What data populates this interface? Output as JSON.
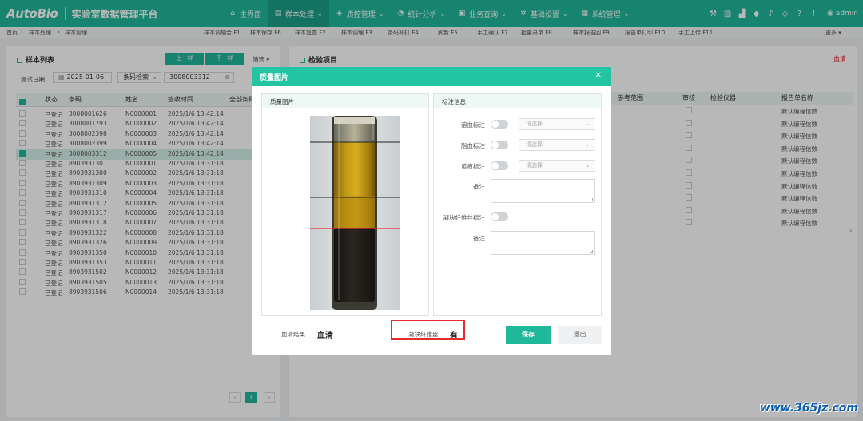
{
  "header": {
    "logo": "AutoBio",
    "app_title": "实验室数据管理平台",
    "nav": [
      {
        "icon": "home-icon",
        "glyph": "⌂",
        "label": "主界面",
        "has_menu": false,
        "active": false
      },
      {
        "icon": "sample-icon",
        "glyph": "▤",
        "label": "样本处理",
        "has_menu": true,
        "active": true
      },
      {
        "icon": "quality-icon",
        "glyph": "◈",
        "label": "质控管理",
        "has_menu": true,
        "active": false
      },
      {
        "icon": "chart-icon",
        "glyph": "◔",
        "label": "统计分析",
        "has_menu": true,
        "active": false
      },
      {
        "icon": "business-icon",
        "glyph": "▣",
        "label": "业务查询",
        "has_menu": true,
        "active": false
      },
      {
        "icon": "gear-icon",
        "glyph": "✲",
        "label": "基础设置",
        "has_menu": true,
        "active": false
      },
      {
        "icon": "grid-icon",
        "glyph": "▦",
        "label": "系统管理",
        "has_menu": true,
        "active": false
      }
    ],
    "tools": [
      {
        "icon": "hammer-icon",
        "glyph": "⚒"
      },
      {
        "icon": "chart-bar-icon",
        "glyph": "▥"
      },
      {
        "icon": "building-icon",
        "glyph": "▟"
      },
      {
        "icon": "shield-icon",
        "glyph": "◆"
      },
      {
        "icon": "bell-icon",
        "glyph": "♪"
      },
      {
        "icon": "cube-icon",
        "glyph": "◇"
      },
      {
        "icon": "help-icon",
        "glyph": "?"
      },
      {
        "icon": "info-icon",
        "glyph": "!"
      }
    ],
    "user": "admin"
  },
  "breadcrumb": {
    "home": "首页",
    "section": "样本处理",
    "page": "样本管理"
  },
  "shortcuts": [
    "样本调轴合 F1",
    "样本保存 F6",
    "样本复查 F2",
    "样本调理 F3",
    "条码补打 F4",
    "刷新 F5",
    "手工确认 F7",
    "批量录单 F8",
    "样本报告回 F9",
    "报告单打印 F10",
    "手工上传 F11",
    "更多 ▾"
  ],
  "left_panel": {
    "title": "样本列表",
    "prev_button": "上一样",
    "next_button": "下一样",
    "filter_button": "筛选 ▾",
    "date_label": "测试日期",
    "date_value": "2025-01-06",
    "search_type": "条码检索",
    "search_value": "3008003312",
    "columns": [
      "状态",
      "条码",
      "姓名",
      "签收时间",
      "全部条码"
    ],
    "rows": [
      {
        "status": "已登记",
        "barcode": "3008001626",
        "name": "N0000001",
        "time": "2025/1/6 13:42:14",
        "selected": false
      },
      {
        "status": "已登记",
        "barcode": "3008001793",
        "name": "N0000002",
        "time": "2025/1/6 13:42:14",
        "selected": false
      },
      {
        "status": "已登记",
        "barcode": "3008002398",
        "name": "N0000003",
        "time": "2025/1/6 13:42:14",
        "selected": false
      },
      {
        "status": "已登记",
        "barcode": "3008002399",
        "name": "N0000004",
        "time": "2025/1/6 13:42:14",
        "selected": false
      },
      {
        "status": "已登记",
        "barcode": "3008003312",
        "name": "N0000005",
        "time": "2025/1/6 13:42:14",
        "selected": true
      },
      {
        "status": "已登记",
        "barcode": "8903931301",
        "name": "N0000001",
        "time": "2025/1/6 13:31:18",
        "selected": false
      },
      {
        "status": "已登记",
        "barcode": "8903931300",
        "name": "N0000002",
        "time": "2025/1/6 13:31:18",
        "selected": false
      },
      {
        "status": "已登记",
        "barcode": "8903931309",
        "name": "N0000003",
        "time": "2025/1/6 13:31:18",
        "selected": false
      },
      {
        "status": "已登记",
        "barcode": "8903931310",
        "name": "N0000004",
        "time": "2025/1/6 13:31:18",
        "selected": false
      },
      {
        "status": "已登记",
        "barcode": "8903931312",
        "name": "N0000005",
        "time": "2025/1/6 13:31:18",
        "selected": false
      },
      {
        "status": "已登记",
        "barcode": "8903931317",
        "name": "N0000006",
        "time": "2025/1/6 13:31:18",
        "selected": false
      },
      {
        "status": "已登记",
        "barcode": "8903931318",
        "name": "N0000007",
        "time": "2025/1/6 13:31:18",
        "selected": false
      },
      {
        "status": "已登记",
        "barcode": "8903931322",
        "name": "N0000008",
        "time": "2025/1/6 13:31:18",
        "selected": false
      },
      {
        "status": "已登记",
        "barcode": "8903931326",
        "name": "N0000009",
        "time": "2025/1/6 13:31:18",
        "selected": false
      },
      {
        "status": "已登记",
        "barcode": "8903931350",
        "name": "N0000010",
        "time": "2025/1/6 13:31:18",
        "selected": false
      },
      {
        "status": "已登记",
        "barcode": "8903931353",
        "name": "N0000011",
        "time": "2025/1/6 13:31:18",
        "selected": false
      },
      {
        "status": "已登记",
        "barcode": "8903931502",
        "name": "N0000012",
        "time": "2025/1/6 13:31:18",
        "selected": false
      },
      {
        "status": "已登记",
        "barcode": "8903931505",
        "name": "N0000013",
        "time": "2025/1/6 13:31:18",
        "selected": false
      },
      {
        "status": "已登记",
        "barcode": "8903931506",
        "name": "N0000014",
        "time": "2025/1/6 13:31:18",
        "selected": false
      }
    ],
    "page_current": "1"
  },
  "right_panel": {
    "title": "检验项目",
    "status": "血清",
    "columns": [
      "参考范围",
      "审核",
      "检验仪器",
      "报告单名称"
    ],
    "report_name": "默认编程信数",
    "row_count": 10
  },
  "modal": {
    "title": "质量图片",
    "image_header": "质量图片",
    "marking_header": "标注信息",
    "hemolysis_label": "溶血标注",
    "lipemia_label": "脂血标注",
    "icterus_label": "黄疸标注",
    "select_placeholder": "请选择",
    "remark_label": "备注",
    "clot_label": "凝块纤维丝标注",
    "result_label": "血清结果",
    "result_value": "血清",
    "fiber_label": "凝块纤维丝",
    "fiber_value": "有",
    "save_button": "保存",
    "exit_button": "退出"
  },
  "watermark": "www.365jz.com",
  "colors": {
    "brand": "#1fb89a",
    "modal_header": "#22c4a3",
    "highlight": "#e52b2b",
    "status_red": "#e02020"
  }
}
